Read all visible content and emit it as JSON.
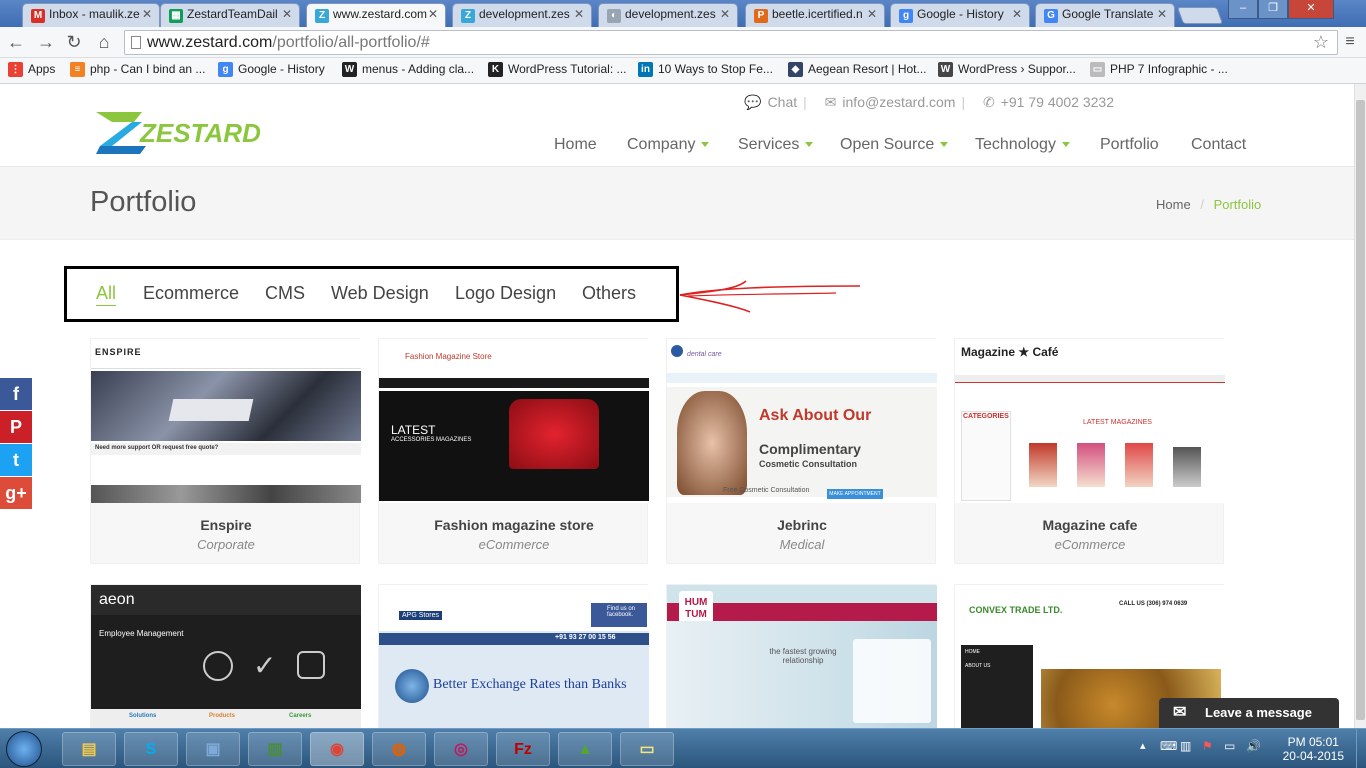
{
  "browser": {
    "tabs": [
      {
        "label": "Inbox - maulik.ze",
        "icon": "gmail-icon",
        "color": "#d93025",
        "glyph": "M"
      },
      {
        "label": "ZestardTeamDail",
        "icon": "sheets-icon",
        "color": "#0f9d58",
        "glyph": "▦"
      },
      {
        "label": "www.zestard.com",
        "icon": "zestard-icon",
        "color": "#39a8d8",
        "glyph": "Z",
        "active": true
      },
      {
        "label": "development.zes",
        "icon": "zestard-icon",
        "color": "#39a8d8",
        "glyph": "Z"
      },
      {
        "label": "development.zes",
        "icon": "generic-page-icon",
        "color": "#9aa5b4",
        "glyph": "◐"
      },
      {
        "label": "beetle.icertified.n",
        "icon": "phpmyadmin-icon",
        "color": "#e06a1a",
        "glyph": "P"
      },
      {
        "label": "Google - History",
        "icon": "google-icon",
        "color": "#4285f4",
        "glyph": "g"
      },
      {
        "label": "Google Translate",
        "icon": "translate-icon",
        "color": "#4285f4",
        "glyph": "G"
      }
    ],
    "window_controls": {
      "minimize": "–",
      "maximize": "❐",
      "close": "✕"
    },
    "url": {
      "host": "www.zestard.com",
      "path": "/portfolio/all-portfolio/#"
    },
    "bookmarks": [
      {
        "label": "Apps",
        "icon": "apps-grid-icon",
        "color": "#e94235",
        "glyph": "⋮"
      },
      {
        "label": "php - Can I bind an ...",
        "icon": "stackoverflow-icon",
        "color": "#f48024",
        "glyph": "≡"
      },
      {
        "label": "Google - History",
        "icon": "google-icon",
        "color": "#4285f4",
        "glyph": "g"
      },
      {
        "label": "menus - Adding cla...",
        "icon": "wordpress-stack-icon",
        "color": "#222222",
        "glyph": "W"
      },
      {
        "label": "WordPress Tutorial: ...",
        "icon": "k-icon",
        "color": "#222222",
        "glyph": "K"
      },
      {
        "label": "10 Ways to Stop Fe...",
        "icon": "linkedin-icon",
        "color": "#0077b5",
        "glyph": "in"
      },
      {
        "label": "Aegean Resort | Hot...",
        "icon": "hotel-icon",
        "color": "#334466",
        "glyph": "◆"
      },
      {
        "label": "WordPress › Suppor...",
        "icon": "wordpress-icon",
        "color": "#464646",
        "glyph": "W"
      },
      {
        "label": "PHP 7 Infographic - ...",
        "icon": "page-icon",
        "color": "#bbbbbb",
        "glyph": "▭"
      }
    ]
  },
  "site": {
    "logo_text": "ZESTARD",
    "contact": {
      "chat": "Chat",
      "email": "info@zestard.com",
      "phone": "+91 79 4002 3232"
    },
    "nav": [
      {
        "label": "Home",
        "dropdown": false
      },
      {
        "label": "Company",
        "dropdown": true
      },
      {
        "label": "Services",
        "dropdown": true
      },
      {
        "label": "Open Source",
        "dropdown": true
      },
      {
        "label": "Technology",
        "dropdown": true
      },
      {
        "label": "Portfolio",
        "dropdown": false
      },
      {
        "label": "Contact",
        "dropdown": false
      }
    ],
    "page_title": "Portfolio",
    "breadcrumb": {
      "home": "Home",
      "separator": "/",
      "current": "Portfolio"
    },
    "filters": [
      "All",
      "Ecommerce",
      "CMS",
      "Web Design",
      "Logo Design",
      "Others"
    ],
    "active_filter": "All",
    "social": [
      {
        "icon": "facebook-icon",
        "glyph": "f",
        "color": "#3b5998"
      },
      {
        "icon": "pinterest-icon",
        "glyph": "P",
        "color": "#cb2027"
      },
      {
        "icon": "twitter-icon",
        "glyph": "t",
        "color": "#1da1f2"
      },
      {
        "icon": "google-plus-icon",
        "glyph": "g+",
        "color": "#dd4b39"
      }
    ],
    "portfolio": [
      {
        "title": "Enspire",
        "category": "Corporate",
        "thumb_text": "ENSPIRE",
        "banner": "Need more support OR request free quote?"
      },
      {
        "title": "Fashion magazine store",
        "category": "eCommerce",
        "thumb_text": "Fashion Magazine Store",
        "banner": "LATEST",
        "sub": "ACCESSORIES MAGAZINES"
      },
      {
        "title": "Jebrinc",
        "category": "Medical",
        "thumb_text": "dental care",
        "banner": "Ask About Our",
        "sub": "Complimentary",
        "sub2": "Cosmetic Consultation",
        "extra": "Free Cosmetic Consultation",
        "button": "MAKE APPOINTMENT"
      },
      {
        "title": "Magazine cafe",
        "category": "eCommerce",
        "thumb_text": "Magazine ★ Café",
        "banner": "CATEGORIES",
        "sub": "LATEST MAGAZINES"
      },
      {
        "thumb_text": "aeon",
        "banner": "Employee Management",
        "sub": "Solutions",
        "extra": "Products",
        "button": "Careers"
      },
      {
        "thumb_text": "APG Stores",
        "banner": "Better Exchange Rates than Banks",
        "sub": "Find us on facebook.",
        "extra": "+91 93 27 00 15 56"
      },
      {
        "thumb_text": "HUM TUM",
        "banner": "the fastest growing relationship"
      },
      {
        "thumb_text": "CONVEX TRADE LTD.",
        "banner": "CALL US (306) 974 0639",
        "sub": "HOME",
        "extra": "ABOUT US"
      }
    ],
    "live_chat": "Leave a message"
  },
  "taskbar": {
    "start_icon": "windows-start-icon",
    "apps": [
      {
        "icon": "explorer-icon",
        "glyph": "▤",
        "color": "#f3c94a"
      },
      {
        "icon": "skype-icon",
        "glyph": "S",
        "color": "#00aff0"
      },
      {
        "icon": "virtualbox-icon",
        "glyph": "▣",
        "color": "#7fa9d9"
      },
      {
        "icon": "gnumeric-icon",
        "glyph": "▥",
        "color": "#4a8c3a"
      },
      {
        "icon": "chrome-icon",
        "glyph": "◉",
        "color": "#db4437"
      },
      {
        "icon": "firefox-icon",
        "glyph": "◍",
        "color": "#e66000"
      },
      {
        "icon": "media-player-icon",
        "glyph": "◎",
        "color": "#c2185b"
      },
      {
        "icon": "filezilla-icon",
        "glyph": "Fz",
        "color": "#bf0000"
      },
      {
        "icon": "bluestacks-icon",
        "glyph": "▲",
        "color": "#55a630"
      },
      {
        "icon": "sticky-notes-icon",
        "glyph": "▭",
        "color": "#f7e47c"
      }
    ],
    "time": "PM 05:01",
    "date": "20-04-2015"
  }
}
